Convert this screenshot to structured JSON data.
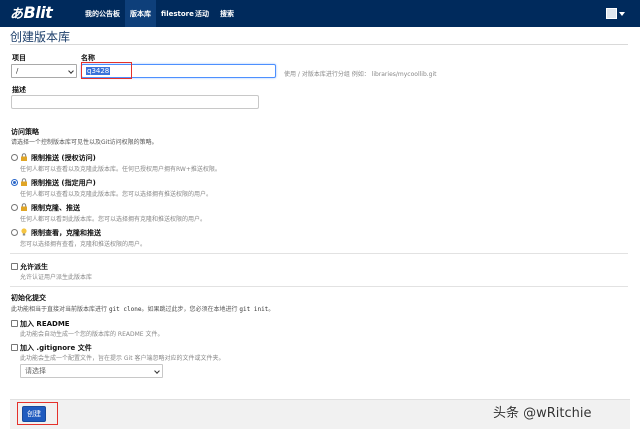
{
  "app": {
    "brand": "Blit",
    "brand_glyph": "あ"
  },
  "nav": {
    "items": [
      {
        "label": "我的公告板",
        "active": false
      },
      {
        "label": "版本库",
        "active": true
      },
      {
        "label": "filestore",
        "active": false
      },
      {
        "label": "活动",
        "active": false
      },
      {
        "label": "搜索",
        "active": false
      }
    ]
  },
  "page": {
    "title": "创建版本库"
  },
  "form": {
    "project_label": "项目",
    "project_value": "/",
    "name_label": "名称",
    "name_value": "q3428",
    "name_hint": "使用 / 对版本库进行分组 例如： libraries/mycoollib.git",
    "description_label": "描述",
    "description_value": "",
    "access_policy": {
      "title": "访问策略",
      "subtitle": "请选择一个控制版本库可见性以及Git访问权限的策略。",
      "options": [
        {
          "label": "限制推送 (授权访问)",
          "desc": "任何人都可以查看以及克隆此版本库。任何已授权用户拥有RW+推送权限。",
          "checked": false,
          "icon": "lock-icon"
        },
        {
          "label": "限制推送 (指定用户)",
          "desc": "任何人都可以查看以及克隆此版本库。您可以选择拥有推送权限的用户。",
          "checked": true,
          "icon": "lock-icon"
        },
        {
          "label": "限制克隆、推送",
          "desc": "任何人都可以看到此版本库。您可以选择拥有克隆和推送权限的用户。",
          "checked": false,
          "icon": "lock-icon"
        },
        {
          "label": "限制查看，克隆和推送",
          "desc": "您可以选择拥有查看，克隆和推送权限的用户。",
          "checked": false,
          "icon": "bulb-icon"
        }
      ]
    },
    "allow_fork": {
      "label": "允许派生",
      "desc": "允许认证用户派生此版本库",
      "checked": false
    },
    "init_commit": {
      "title": "初始化提交",
      "desc_pre": "此功能相当于直接对当前版本库进行",
      "cmd1": "git clone",
      "desc_mid": "。如果跳过此步，您必须在本地进行",
      "cmd2": "git init",
      "desc_post": "。"
    },
    "add_readme": {
      "label": "加入 README",
      "desc": "此功能会自动生成一个您的版本库的 README 文件。",
      "checked": false
    },
    "add_gitignore": {
      "label": "加入 .gitignore 文件",
      "desc": "此功能会生成一个配置文件，旨在提示 Git 客户端忽略对应的文件或文件夹。",
      "checked": false,
      "select_value": "请选择"
    },
    "submit_label": "创建"
  },
  "watermark": "头条 @wRitchie",
  "colors": {
    "navbar": "#002a5c",
    "primary": "#1f5bbf",
    "highlight": "#e4312b"
  }
}
